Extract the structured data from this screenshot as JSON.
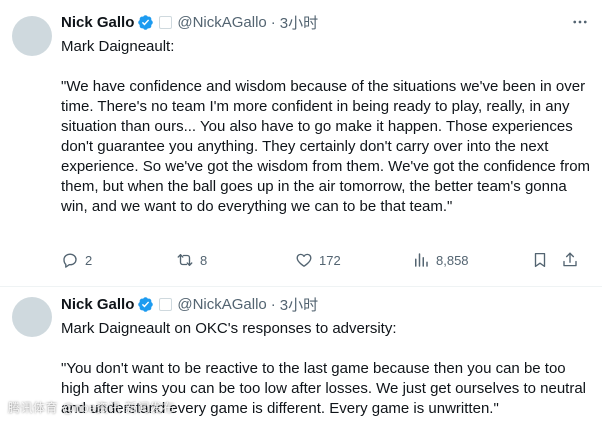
{
  "colors": {
    "text_primary": "#0f1419",
    "text_secondary": "#536471",
    "verified_blue": "#1d9bf0",
    "divider": "#eff3f4",
    "avatar_placeholder": "#cfd9de"
  },
  "tweets": [
    {
      "author_name": "Nick Gallo",
      "handle": "@NickAGallo",
      "separator": "·",
      "time": "3小时",
      "paragraphs": [
        "Mark Daigneault:",
        "\"We have confidence and wisdom because of the situations we've been in over time. There's no team I'm more confident in being ready to play, really, in any situation than ours... You also have to go make it happen. Those experiences don't guarantee you anything. They certainly don't carry over into the next experience. So we've got the wisdom from them. We've got the confidence from them, but when the ball goes up in the air tomorrow, the better team's gonna win, and we want to do everything we can to be that team.\""
      ],
      "stats": {
        "replies": "2",
        "reposts": "8",
        "likes": "172",
        "views": "8,858"
      }
    },
    {
      "author_name": "Nick Gallo",
      "handle": "@NickAGallo",
      "separator": "·",
      "time": "3小时",
      "paragraphs": [
        "Mark Daigneault on OKC's responses to adversity:",
        "\"You don't want to be reactive to the last game because then you can be too high after wins you can be too low after losses. We just get ourselves to neutral and understand every game is different. Every game is unwritten.\""
      ]
    }
  ],
  "icons": {
    "verified": "verified-badge-icon",
    "affiliate": "affiliate-badge-icon",
    "more": "more-options-icon",
    "reply": "reply-icon",
    "repost": "repost-icon",
    "like": "heart-icon",
    "views": "views-chart-icon",
    "bookmark": "bookmark-icon",
    "share": "share-icon"
  },
  "watermark": "腾讯体育 @nba资讯 新闻发布"
}
